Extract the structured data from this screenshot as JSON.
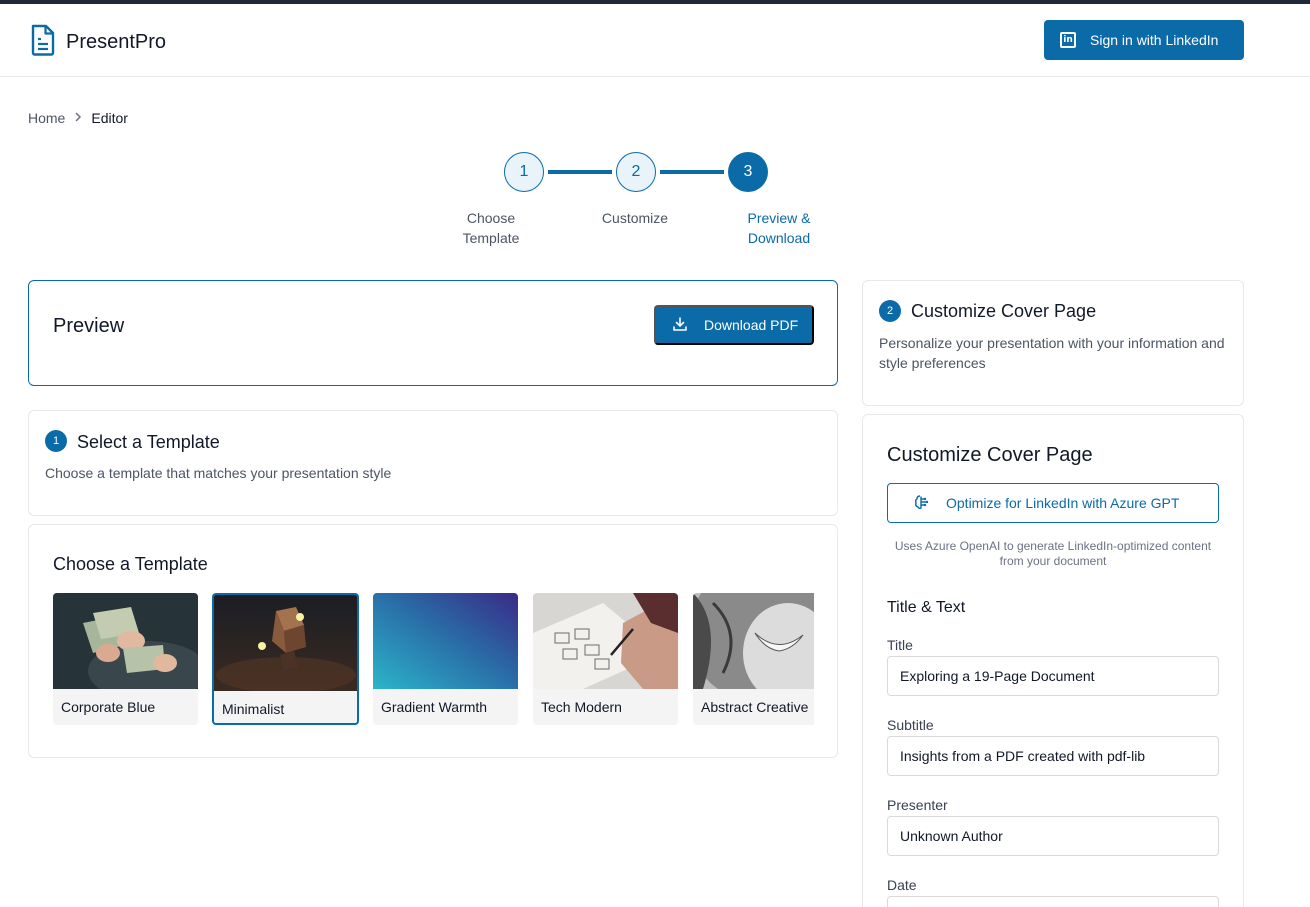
{
  "header": {
    "brand_name": "PresentPro",
    "signin_label": "Sign in with LinkedIn"
  },
  "breadcrumb": {
    "items": [
      "Home",
      "Editor"
    ]
  },
  "stepper": {
    "steps": [
      {
        "number": "1",
        "label": "Choose Template",
        "state": "completed"
      },
      {
        "number": "2",
        "label": "Customize",
        "state": "completed"
      },
      {
        "number": "3",
        "label": "Preview & Download",
        "state": "active"
      }
    ]
  },
  "preview": {
    "title": "Preview",
    "download_label": "Download PDF"
  },
  "select_template": {
    "badge": "1",
    "title": "Select a Template",
    "description": "Choose a template that matches your presentation style"
  },
  "templates": {
    "heading": "Choose a Template",
    "items": [
      {
        "name": "Corporate Blue"
      },
      {
        "name": "Minimalist",
        "selected": true
      },
      {
        "name": "Gradient Warmth"
      },
      {
        "name": "Tech Modern"
      },
      {
        "name": "Abstract Creative"
      }
    ]
  },
  "customize_header": {
    "badge": "2",
    "title": "Customize Cover Page",
    "description": "Personalize your presentation with your information and style preferences"
  },
  "customize": {
    "title": "Customize Cover Page",
    "optimize_label": "Optimize for LinkedIn with Azure GPT",
    "optimize_note": "Uses Azure OpenAI to generate LinkedIn-optimized content from your document",
    "group_title": "Title & Text",
    "fields": {
      "title_label": "Title",
      "title_value": "Exploring a 19-Page Document",
      "subtitle_label": "Subtitle",
      "subtitle_value": "Insights from a PDF created with pdf-lib",
      "presenter_label": "Presenter",
      "presenter_value": "Unknown Author",
      "date_label": "Date"
    }
  },
  "colors": {
    "accent": "#0b6aa8",
    "header_strip": "#1f2937"
  },
  "icons": {
    "brand": "document-icon",
    "signin": "linkedin-icon",
    "download": "download-icon",
    "optimize": "brain-icon",
    "breadcrumb_separator": "chevron-right-icon"
  }
}
